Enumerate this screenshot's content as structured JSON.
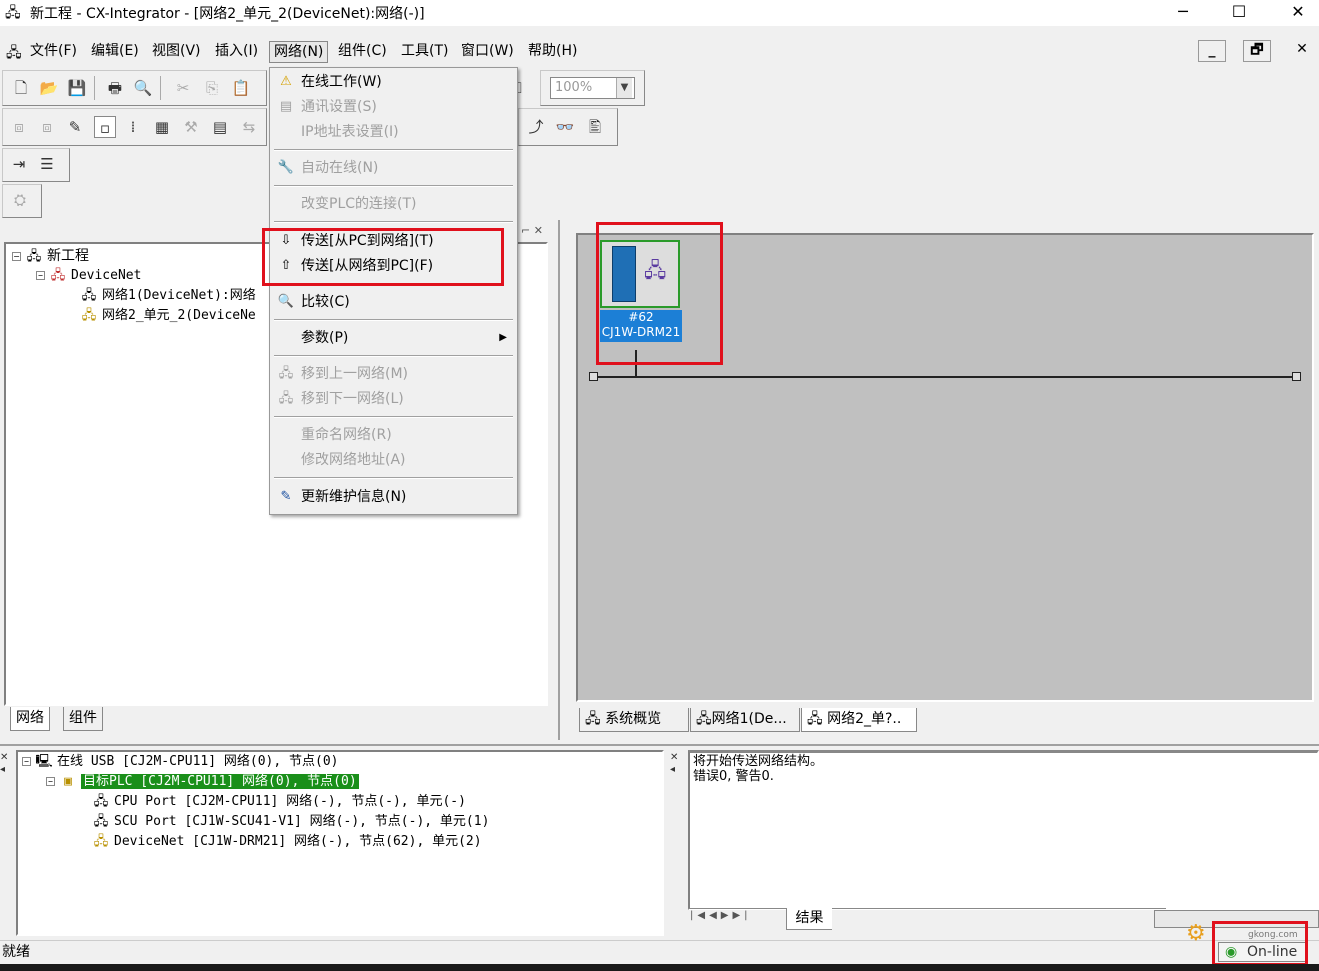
{
  "window": {
    "title": "新工程 - CX-Integrator - [网络2_单元_2(DeviceNet):网络(-)]",
    "minimize": "─",
    "maximize": "☐",
    "close": "✕"
  },
  "menubar": {
    "items": [
      "文件(F)",
      "编辑(E)",
      "视图(V)",
      "插入(I)",
      "网络(N)",
      "组件(C)",
      "工具(T)",
      "窗口(W)",
      "帮助(H)"
    ],
    "active_index": 4,
    "mdi_minimize": "_",
    "mdi_restore": "🗗",
    "mdi_close": "✕"
  },
  "toolbar": {
    "zoom_value": "100%",
    "zoom_arrow": "▼",
    "icons_row1": [
      "new-icon",
      "open-icon",
      "save-icon",
      "print-icon",
      "print-preview-icon",
      "cut-icon",
      "copy-icon",
      "paste-icon"
    ],
    "icons_row2": [
      "network-icon",
      "network2-icon",
      "maintenance-icon",
      "node-icon",
      "parameter-icon",
      "table-icon",
      "tools-icon",
      "memo-icon",
      "transfer-icon"
    ]
  },
  "network_menu": {
    "items": [
      {
        "label": "在线工作(W)",
        "icon": "warning-icon",
        "enabled": true
      },
      {
        "label": "通讯设置(S)",
        "icon": "comm-icon",
        "enabled": false
      },
      {
        "label": "IP地址表设置(I)",
        "icon": "",
        "enabled": false
      },
      {
        "label": "自动在线(N)",
        "icon": "auto-online-icon",
        "enabled": false
      },
      {
        "label": "改变PLC的连接(T)",
        "icon": "",
        "enabled": false
      },
      {
        "label": "传送[从PC到网络](T)",
        "icon": "pc-to-network-icon",
        "enabled": true
      },
      {
        "label": "传送[从网络到PC](F)",
        "icon": "network-to-pc-icon",
        "enabled": true
      },
      {
        "label": "比较(C)",
        "icon": "compare-icon",
        "enabled": true
      },
      {
        "label": "参数(P)",
        "icon": "",
        "enabled": true,
        "submenu": "▶"
      },
      {
        "label": "移到上一网络(M)",
        "icon": "up-network-icon",
        "enabled": false
      },
      {
        "label": "移到下一网络(L)",
        "icon": "down-network-icon",
        "enabled": false
      },
      {
        "label": "重命名网络(R)",
        "icon": "",
        "enabled": false
      },
      {
        "label": "修改网络地址(A)",
        "icon": "",
        "enabled": false
      },
      {
        "label": "更新维护信息(N)",
        "icon": "update-maint-icon",
        "enabled": true
      }
    ]
  },
  "project_tree": {
    "root": "新工程",
    "child": "DeviceNet",
    "networks": [
      "网络1(DeviceNet):网络",
      "网络2_单元_2(DeviceNe"
    ],
    "tabs": [
      "网络",
      "组件"
    ],
    "close_glyph": "✕"
  },
  "network_view": {
    "node_number": "#62",
    "node_model": "CJ1W-DRM21",
    "tabs": [
      "系统概览",
      "网络1(De...",
      "网络2_单?.."
    ]
  },
  "online_tree": {
    "rows": [
      "在线 USB  [CJ2M-CPU11] 网络(0), 节点(0)",
      "目标PLC [CJ2M-CPU11] 网络(0), 节点(0)",
      "CPU Port [CJ2M-CPU11] 网络(-), 节点(-), 单元(-)",
      "SCU Port [CJ1W-SCU41-V1] 网络(-), 节点(-), 单元(1)",
      "DeviceNet [CJ1W-DRM21] 网络(-), 节点(62), 单元(2)"
    ]
  },
  "output": {
    "lines": [
      "将开始传送网络结构。",
      "错误0, 警告0."
    ],
    "tab": "结果",
    "nav": [
      "|◀",
      "◀",
      "▶",
      "▶|"
    ]
  },
  "status": {
    "text": "就绪",
    "online": "On-line",
    "watermark_site": "gkong.com"
  },
  "colors": {
    "highlight_red": "#e0101c",
    "selection_blue": "#1c7fd6",
    "target_plc_green": "#1a8f1a",
    "canvas_gray": "#c0c0c0"
  }
}
